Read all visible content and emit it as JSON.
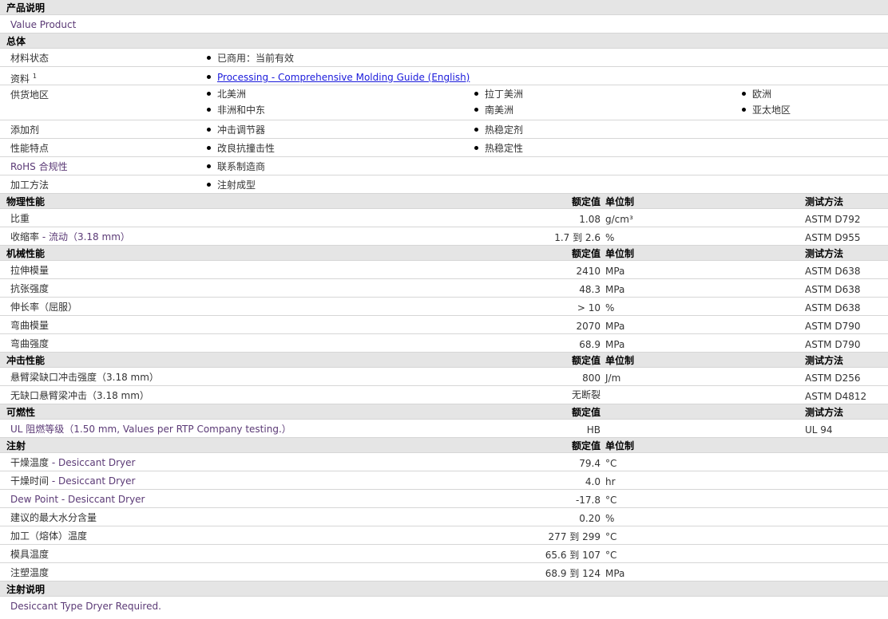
{
  "headers": {
    "product": "产品说明",
    "general": "总体",
    "physical": "物理性能",
    "mechanical": "机械性能",
    "impact": "冲击性能",
    "flammability": "可燃性",
    "injection": "注射",
    "injection_notes": "注射说明"
  },
  "columns": {
    "nominal": "额定值",
    "unit": "单位制",
    "method": "测试方法"
  },
  "product_description": "Value Product",
  "general": {
    "material_status_label": "材料状态",
    "material_status_value": "已商用：当前有效",
    "docs_label": "资料",
    "docs_sup": "1",
    "docs_link": "Processing - Comprehensive Molding Guide (English)",
    "region_label": "供货地区",
    "regions": [
      "北美洲",
      "拉丁美洲",
      "欧洲",
      "非洲和中东",
      "南美洲",
      "亚太地区"
    ],
    "additive_label": "添加剂",
    "additives": [
      "冲击调节器",
      "热稳定剂"
    ],
    "features_label": "性能特点",
    "features": [
      "改良抗撞击性",
      "热稳定性"
    ],
    "rohs_label": "RoHS 合规性",
    "rohs_value": "联系制造商",
    "process_label": "加工方法",
    "process_value": "注射成型"
  },
  "physical": [
    {
      "name": "比重",
      "suffix": "",
      "value": "1.08",
      "unit": "g/cm³",
      "method": "ASTM D792"
    },
    {
      "name": "收缩率",
      "suffix": " - 流动（3.18 mm）",
      "value": "1.7 到  2.6",
      "unit": "%",
      "method": "ASTM D955"
    }
  ],
  "mechanical": [
    {
      "name": "拉伸模量",
      "value": "2410",
      "unit": "MPa",
      "method": "ASTM D638"
    },
    {
      "name": "抗张强度",
      "value": "48.3",
      "unit": "MPa",
      "method": "ASTM D638"
    },
    {
      "name": "伸长率（屈服）",
      "value": "> 10",
      "unit": "%",
      "method": "ASTM D638"
    },
    {
      "name": "弯曲模量",
      "value": "2070",
      "unit": "MPa",
      "method": "ASTM D790"
    },
    {
      "name": "弯曲强度",
      "value": "68.9",
      "unit": "MPa",
      "method": "ASTM D790"
    }
  ],
  "impact": [
    {
      "name": "悬臂梁缺口冲击强度（3.18 mm）",
      "value": "800",
      "unit": "J/m",
      "method": "ASTM D256"
    },
    {
      "name": "无缺口悬臂梁冲击（3.18 mm）",
      "value": "无断裂",
      "unit": "",
      "method": "ASTM D4812"
    }
  ],
  "flammability": [
    {
      "name": "UL 阻燃等级（1.50 mm, Values per RTP Company testing.）",
      "value": "HB",
      "unit": "",
      "method": "UL 94"
    }
  ],
  "injection": [
    {
      "name": "干燥温度",
      "suffix": " - Desiccant Dryer",
      "value": "79.4",
      "unit": "°C"
    },
    {
      "name": "干燥时间",
      "suffix": " - Desiccant Dryer",
      "value": "4.0",
      "unit": "hr"
    },
    {
      "name": "Dew Point - Desiccant Dryer",
      "suffix": "",
      "value": "-17.8",
      "unit": "°C"
    },
    {
      "name": "建议的最大水分含量",
      "suffix": "",
      "value": "0.20",
      "unit": "%"
    },
    {
      "name": "加工（熔体）温度",
      "suffix": "",
      "value": "277 到  299",
      "unit": "°C"
    },
    {
      "name": "模具温度",
      "suffix": "",
      "value": "65.6 到  107",
      "unit": "°C"
    },
    {
      "name": "注塑温度",
      "suffix": "",
      "value": "68.9 到  124",
      "unit": "MPa"
    }
  ],
  "injection_note": "Desiccant Type Dryer Required."
}
